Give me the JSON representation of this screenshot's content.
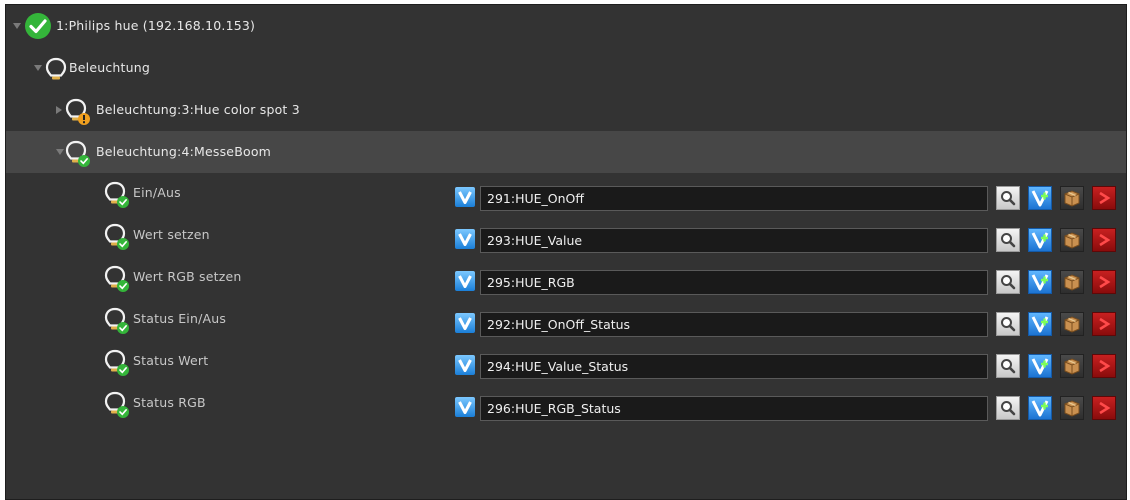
{
  "tree": {
    "root": {
      "label": "1:Philips hue (192.168.10.153)"
    },
    "group": {
      "label": "Beleuchtung"
    },
    "devices": [
      {
        "label": "Beleuchtung:3:Hue color spot 3",
        "expanded": false,
        "status": "warning"
      },
      {
        "label": "Beleuchtung:4:MesseBoom",
        "expanded": true,
        "status": "ok",
        "selected": true
      }
    ],
    "parameters": [
      {
        "label": "Ein/Aus",
        "variable": "291:HUE_OnOff"
      },
      {
        "label": "Wert setzen",
        "variable": "293:HUE_Value"
      },
      {
        "label": "Wert RGB setzen",
        "variable": "295:HUE_RGB"
      },
      {
        "label": "Status Ein/Aus",
        "variable": "292:HUE_OnOff_Status"
      },
      {
        "label": "Status Wert",
        "variable": "294:HUE_Value_Status"
      },
      {
        "label": "Status RGB",
        "variable": "296:HUE_RGB_Status"
      }
    ]
  },
  "colors": {
    "ok": "#34b53a",
    "warning": "#f0a020",
    "bulb_outline": "#f2f2f2",
    "selection": "#474747",
    "panel": "#333333"
  },
  "icons": {
    "parameter_type": "variable-v-icon",
    "actions": [
      "search-icon",
      "variable-link-icon",
      "box-icon",
      "delete-icon"
    ]
  }
}
